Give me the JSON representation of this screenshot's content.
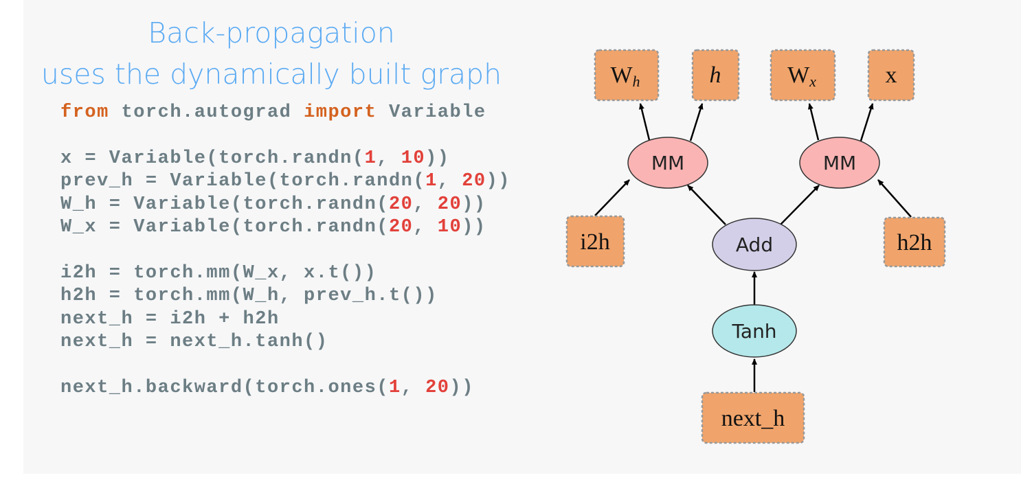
{
  "title": {
    "line1": "Back-propagation",
    "line2": "uses the dynamically built graph"
  },
  "code": [
    [
      {
        "t": "from",
        "k": "kw"
      },
      {
        "t": " torch.autograd "
      },
      {
        "t": "import",
        "k": "kw"
      },
      {
        "t": " Variable"
      }
    ],
    [],
    [
      {
        "t": "x = Variable(torch.randn("
      },
      {
        "t": "1",
        "k": "num"
      },
      {
        "t": ", "
      },
      {
        "t": "10",
        "k": "num"
      },
      {
        "t": "))"
      }
    ],
    [
      {
        "t": "prev_h = Variable(torch.randn("
      },
      {
        "t": "1",
        "k": "num"
      },
      {
        "t": ", "
      },
      {
        "t": "20",
        "k": "num"
      },
      {
        "t": "))"
      }
    ],
    [
      {
        "t": "W_h = Variable(torch.randn("
      },
      {
        "t": "20",
        "k": "num"
      },
      {
        "t": ", "
      },
      {
        "t": "20",
        "k": "num"
      },
      {
        "t": "))"
      }
    ],
    [
      {
        "t": "W_x = Variable(torch.randn("
      },
      {
        "t": "20",
        "k": "num"
      },
      {
        "t": ", "
      },
      {
        "t": "10",
        "k": "num"
      },
      {
        "t": "))"
      }
    ],
    [],
    [
      {
        "t": "i2h = torch.mm(W_x, x.t())"
      }
    ],
    [
      {
        "t": "h2h = torch.mm(W_h, prev_h.t())"
      }
    ],
    [
      {
        "t": "next_h = i2h + h2h"
      }
    ],
    [
      {
        "t": "next_h = next_h.tanh()"
      }
    ],
    [],
    [
      {
        "t": "next_h.backward(torch.ones("
      },
      {
        "t": "1",
        "k": "num"
      },
      {
        "t": ", "
      },
      {
        "t": "20",
        "k": "num"
      },
      {
        "t": "))"
      }
    ]
  ],
  "graph": {
    "nodes": {
      "wh": {
        "base": "W",
        "sub": "h"
      },
      "h": "h",
      "wx": {
        "base": "W",
        "sub": "x"
      },
      "x": "x",
      "mm1": "MM",
      "mm2": "MM",
      "i2h": "i2h",
      "h2h": "h2h",
      "add": "Add",
      "tanh": "Tanh",
      "next_h": "next_h"
    },
    "colors": {
      "variable": "#f0a46b",
      "mm": "#fab4b4",
      "add": "#d4cfe8",
      "tanh": "#b5e8ea"
    }
  }
}
